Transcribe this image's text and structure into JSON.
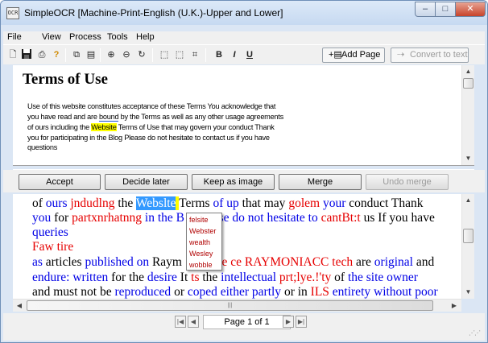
{
  "window": {
    "title": "SimpleOCR [Machine-Print-English (U.K.)-Upper and Lower]",
    "app_icon": "ocr-app-icon",
    "controls": {
      "minimize": "–",
      "maximize": "□",
      "close": "✕"
    }
  },
  "menu": [
    "File",
    "View",
    "Process",
    "Tools",
    "Help"
  ],
  "toolbar": {
    "icons": [
      {
        "name": "new-icon",
        "glyph": "🗋"
      },
      {
        "name": "save-icon",
        "glyph": "💾"
      },
      {
        "name": "scan-icon",
        "glyph": "⎙"
      },
      {
        "name": "help-icon",
        "glyph": "?"
      },
      {
        "name": "copy-icon",
        "glyph": "⧉"
      },
      {
        "name": "document-icon",
        "glyph": "▤"
      },
      {
        "name": "zoom-in-icon",
        "glyph": "⊕"
      },
      {
        "name": "zoom-out-icon",
        "glyph": "⊖"
      },
      {
        "name": "rotate-icon",
        "glyph": "↻"
      },
      {
        "name": "select-region-icon",
        "glyph": "⬚"
      },
      {
        "name": "crop-icon",
        "glyph": "⬚"
      },
      {
        "name": "auto-zone-icon",
        "glyph": "⌗"
      },
      {
        "name": "bold-icon",
        "glyph": "B"
      },
      {
        "name": "italic-icon",
        "glyph": "I"
      },
      {
        "name": "underline-icon",
        "glyph": "U"
      }
    ],
    "add_page": {
      "icon": "add-page-icon",
      "label": "Add Page"
    },
    "convert_to_text": {
      "icon": "convert-icon",
      "label": "Convert to text"
    }
  },
  "source_image": {
    "heading": "Terms of Use",
    "lines": [
      {
        "parts": [
          {
            "t": "Use of this website constitutes acceptance of these Terms  You acknowledge that"
          }
        ]
      },
      {
        "parts": [
          {
            "t": "you have read and are "
          },
          {
            "t": "bound",
            "hl": "box"
          },
          {
            "t": " by the Terms  as well as any other usage agreements"
          }
        ]
      },
      {
        "parts": [
          {
            "t": "of ours  including the "
          },
          {
            "t": "Website",
            "hl": "yellow"
          },
          {
            "t": " Terms of Use that may govern your conduct  Thank"
          }
        ]
      },
      {
        "parts": [
          {
            "t": "you for participating in the Blog  Please do not hesitate to contact us if you have"
          }
        ]
      },
      {
        "parts": [
          {
            "t": "questions"
          }
        ]
      }
    ]
  },
  "actions": {
    "accept": "Accept",
    "decide_later": "Decide later",
    "keep_as_image": "Keep as image",
    "merge": "Merge",
    "undo_merge": "Undo merge"
  },
  "ocr_text": {
    "lines": [
      [
        {
          "t": "of ",
          "c": "k"
        },
        {
          "t": "ours",
          "c": "b"
        },
        {
          "t": " ",
          "c": "k"
        },
        {
          "t": "jndudlng",
          "c": "r"
        },
        {
          "t": " the ",
          "c": "k"
        },
        {
          "t": "Webslte",
          "c": "sel"
        },
        {
          "t": " ",
          "c": "cur"
        },
        {
          "t": "Terms ",
          "c": "k"
        },
        {
          "t": "of up",
          "c": "b"
        },
        {
          "t": " that may ",
          "c": "k"
        },
        {
          "t": "golem",
          "c": "r"
        },
        {
          "t": " ",
          "c": "k"
        },
        {
          "t": "your",
          "c": "b"
        },
        {
          "t": " conduct Thank",
          "c": "k"
        }
      ],
      [
        {
          "t": "you",
          "c": "b"
        },
        {
          "t": " for ",
          "c": "k"
        },
        {
          "t": "partxnrhatnng",
          "c": "r"
        },
        {
          "t": " in the B",
          "c": "b"
        },
        {
          "t": "           ",
          "c": "k"
        },
        {
          "t": "se do not ",
          "c": "b"
        },
        {
          "t": "hesitate to",
          "c": "b"
        },
        {
          "t": " ",
          "c": "k"
        },
        {
          "t": "cantBt:t",
          "c": "r"
        },
        {
          "t": " us If you have",
          "c": "k"
        }
      ],
      [
        {
          "t": "queries",
          "c": "b"
        }
      ],
      [
        {
          "t": "Faw tire",
          "c": "r"
        }
      ],
      [
        {
          "t": "as",
          "c": "b"
        },
        {
          "t": " articles ",
          "c": "k"
        },
        {
          "t": "published on",
          "c": "b"
        },
        {
          "t": " Raym",
          "c": "k"
        },
        {
          "t": "           ",
          "c": "k"
        },
        {
          "t": "ce ce RAYMONIACC",
          "c": "r"
        },
        {
          "t": " tech",
          "c": "r"
        },
        {
          "t": " are ",
          "c": "k"
        },
        {
          "t": "original",
          "c": "b"
        },
        {
          "t": " and",
          "c": "k"
        }
      ],
      [
        {
          "t": "endure: written",
          "c": "b"
        },
        {
          "t": " for the ",
          "c": "k"
        },
        {
          "t": "desire",
          "c": "b"
        },
        {
          "t": " It ",
          "c": "k"
        },
        {
          "t": "ts",
          "c": "r"
        },
        {
          "t": " the ",
          "c": "k"
        },
        {
          "t": "intellectual",
          "c": "b"
        },
        {
          "t": " ",
          "c": "k"
        },
        {
          "t": "prt;lye.!'ty",
          "c": "r"
        },
        {
          "t": " of ",
          "c": "k"
        },
        {
          "t": "the site owner",
          "c": "b"
        }
      ],
      [
        {
          "t": "and must not be ",
          "c": "k"
        },
        {
          "t": "reproduced",
          "c": "b"
        },
        {
          "t": " or ",
          "c": "k"
        },
        {
          "t": "coped either partly",
          "c": "b"
        },
        {
          "t": " or in ",
          "c": "k"
        },
        {
          "t": "ILS",
          "c": "r"
        },
        {
          "t": " ",
          "c": "k"
        },
        {
          "t": "entirety without poor",
          "c": "b"
        }
      ]
    ],
    "suggestions": [
      "felsite",
      "Webster",
      "wealth",
      "Wesley",
      "wobble"
    ]
  },
  "pager": {
    "label": "Page 1 of 1"
  },
  "colors": {
    "unknown_word": "#e60000",
    "dictionary_word": "#0000e6",
    "selection": "#3399ff",
    "highlight": "#ffff00"
  }
}
